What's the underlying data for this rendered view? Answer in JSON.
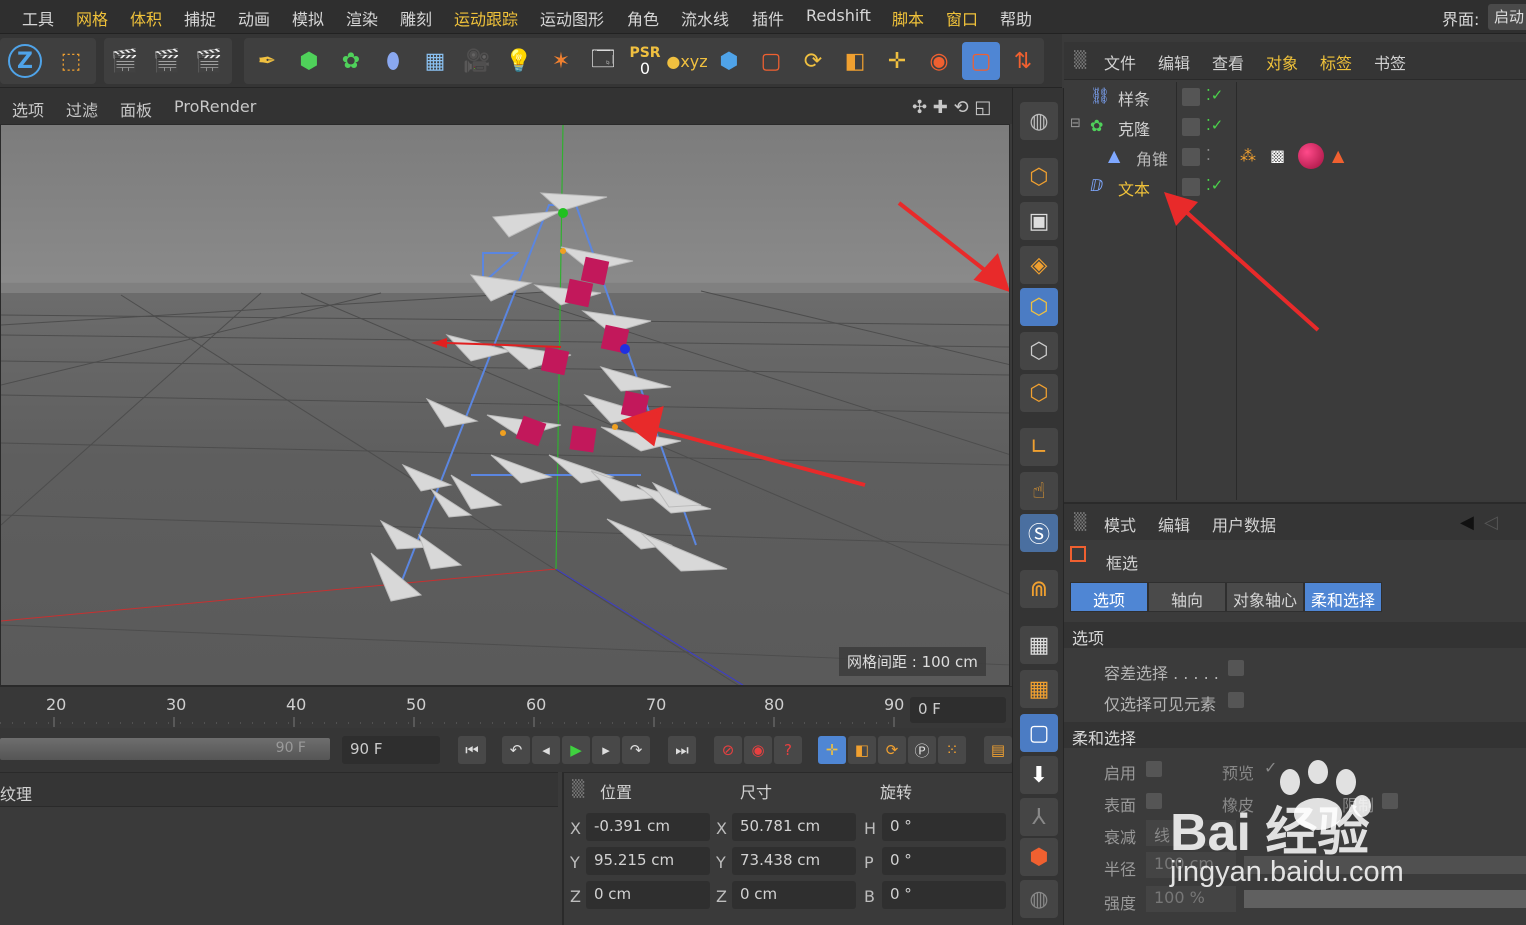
{
  "menu": {
    "items": [
      "工具",
      "网格",
      "体积",
      "捕捉",
      "动画",
      "模拟",
      "渲染",
      "雕刻",
      "运动跟踪",
      "运动图形",
      "角色",
      "流水线",
      "插件",
      "Redshift",
      "脚本",
      "窗口",
      "帮助"
    ],
    "layout_label": "界面:",
    "layout_value": "启动"
  },
  "toolbar": {
    "psr_label": "PSR",
    "psr_value": "0",
    "icons": [
      "z-lock-icon",
      "coordinate-icon",
      "render-view-icon",
      "render-picture-icon",
      "render-settings-icon",
      "pen-icon",
      "cube-green-icon",
      "mograph-cloner-icon",
      "deformer-icon",
      "floor-icon",
      "camera-icon",
      "light-icon",
      "effector-icon",
      "tag-icon",
      "psr-icon",
      "axis-icon",
      "cube-blue-icon",
      "rectangle-select-icon",
      "rotate-icon",
      "scale-icon",
      "move-icon",
      "live-select-icon",
      "box-select-icon",
      "axis-tool-icon"
    ]
  },
  "viewport_menu": {
    "items": [
      "选项",
      "过滤",
      "面板",
      "ProRender"
    ],
    "grid_spacing": "网格间距 : 100 cm"
  },
  "object_manager": {
    "header": [
      "文件",
      "编辑",
      "查看",
      "对象",
      "标签",
      "书签"
    ],
    "objects": [
      {
        "name": "样条",
        "icon": "spline-icon",
        "checked": true
      },
      {
        "name": "克隆",
        "icon": "cloner-icon",
        "checked": true
      },
      {
        "name": "角锥",
        "icon": "pyramid-icon",
        "checked": false
      },
      {
        "name": "文本",
        "icon": "text-spline-icon",
        "checked": true
      }
    ]
  },
  "attributes": {
    "header": [
      "模式",
      "编辑",
      "用户数据"
    ],
    "tool_name": "框选",
    "tabs": [
      "选项",
      "轴向",
      "对象轴心",
      "柔和选择"
    ],
    "section_options": "选项",
    "option_rows": [
      "容差选择 . . . . .",
      "仅选择可见元素"
    ],
    "section_soft": "柔和选择",
    "soft_rows": {
      "enable": "启用",
      "preview": "预览",
      "surface": "表面",
      "rubber": "橡皮",
      "limit": "限制",
      "falloff": "衰减",
      "falloff_value": "线",
      "radius": "半径",
      "radius_value": "100 cm",
      "strength": "强度",
      "strength_value": "100 %"
    }
  },
  "timeline": {
    "ticks": [
      "20",
      "30",
      "40",
      "50",
      "60",
      "70",
      "80",
      "90"
    ],
    "current_frame": "0 F",
    "range_end_label": "90 F",
    "end_frame": "90 F"
  },
  "material": {
    "label": "纹理"
  },
  "coords": {
    "headers": [
      "位置",
      "尺寸",
      "旋转"
    ],
    "position": {
      "X": "-0.391 cm",
      "Y": "95.215 cm",
      "Z": "0 cm"
    },
    "size": {
      "X": "50.781 cm",
      "Y": "73.438 cm",
      "Z": "0 cm"
    },
    "rotation": {
      "H": "0 °",
      "P": "0 °",
      "B": "0 °"
    }
  },
  "watermark": {
    "brand": "Bai 经验",
    "url": "jingyan.baidu.com"
  },
  "colors": {
    "accent_blue": "#4f86d4",
    "highlight_yellow": "#f0c23a",
    "arrow_red": "#e82a2a",
    "magenta": "#c2185b"
  }
}
